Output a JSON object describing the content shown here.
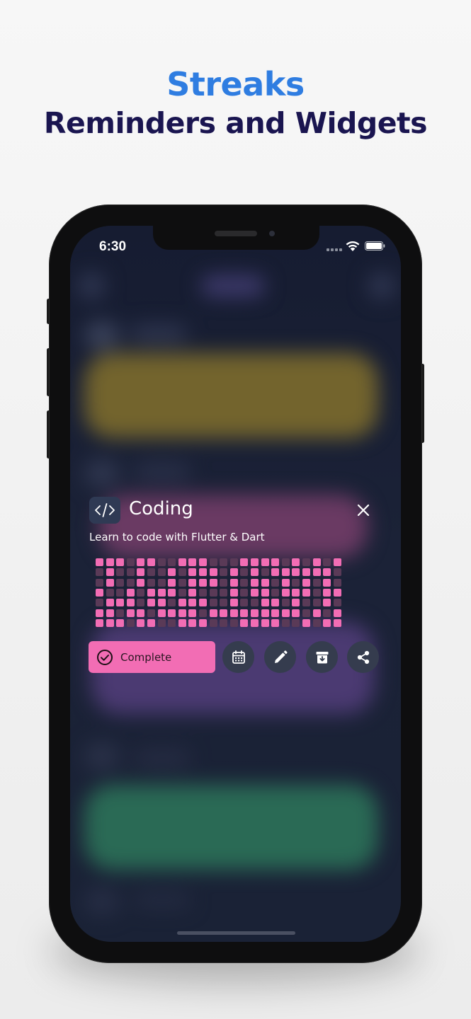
{
  "headline": {
    "line1": "Streaks",
    "line2": "Reminders and Widgets"
  },
  "status_bar": {
    "time": "6:30"
  },
  "habit_card": {
    "icon": "code-icon",
    "title": "Coding",
    "description": "Learn to code with Flutter & Dart",
    "accent_color": "#f26db4",
    "dim_color": "#5a3a57",
    "complete_label": "Complete",
    "actions": [
      "calendar-icon",
      "edit-icon",
      "archive-icon",
      "share-icon"
    ],
    "grid_rows": [
      "111011001110001111010101",
      "010010010111010101111110",
      "010010010111010110101010",
      "100101110100010110111011",
      "011101101110010011010010",
      "110110111101111111110101",
      "111011001110001111001011"
    ]
  },
  "colors": {
    "headline_blue": "#2f7de1",
    "headline_navy": "#1a1550",
    "screen_bg": "#1b2237",
    "button_bg": "#353c4e"
  }
}
